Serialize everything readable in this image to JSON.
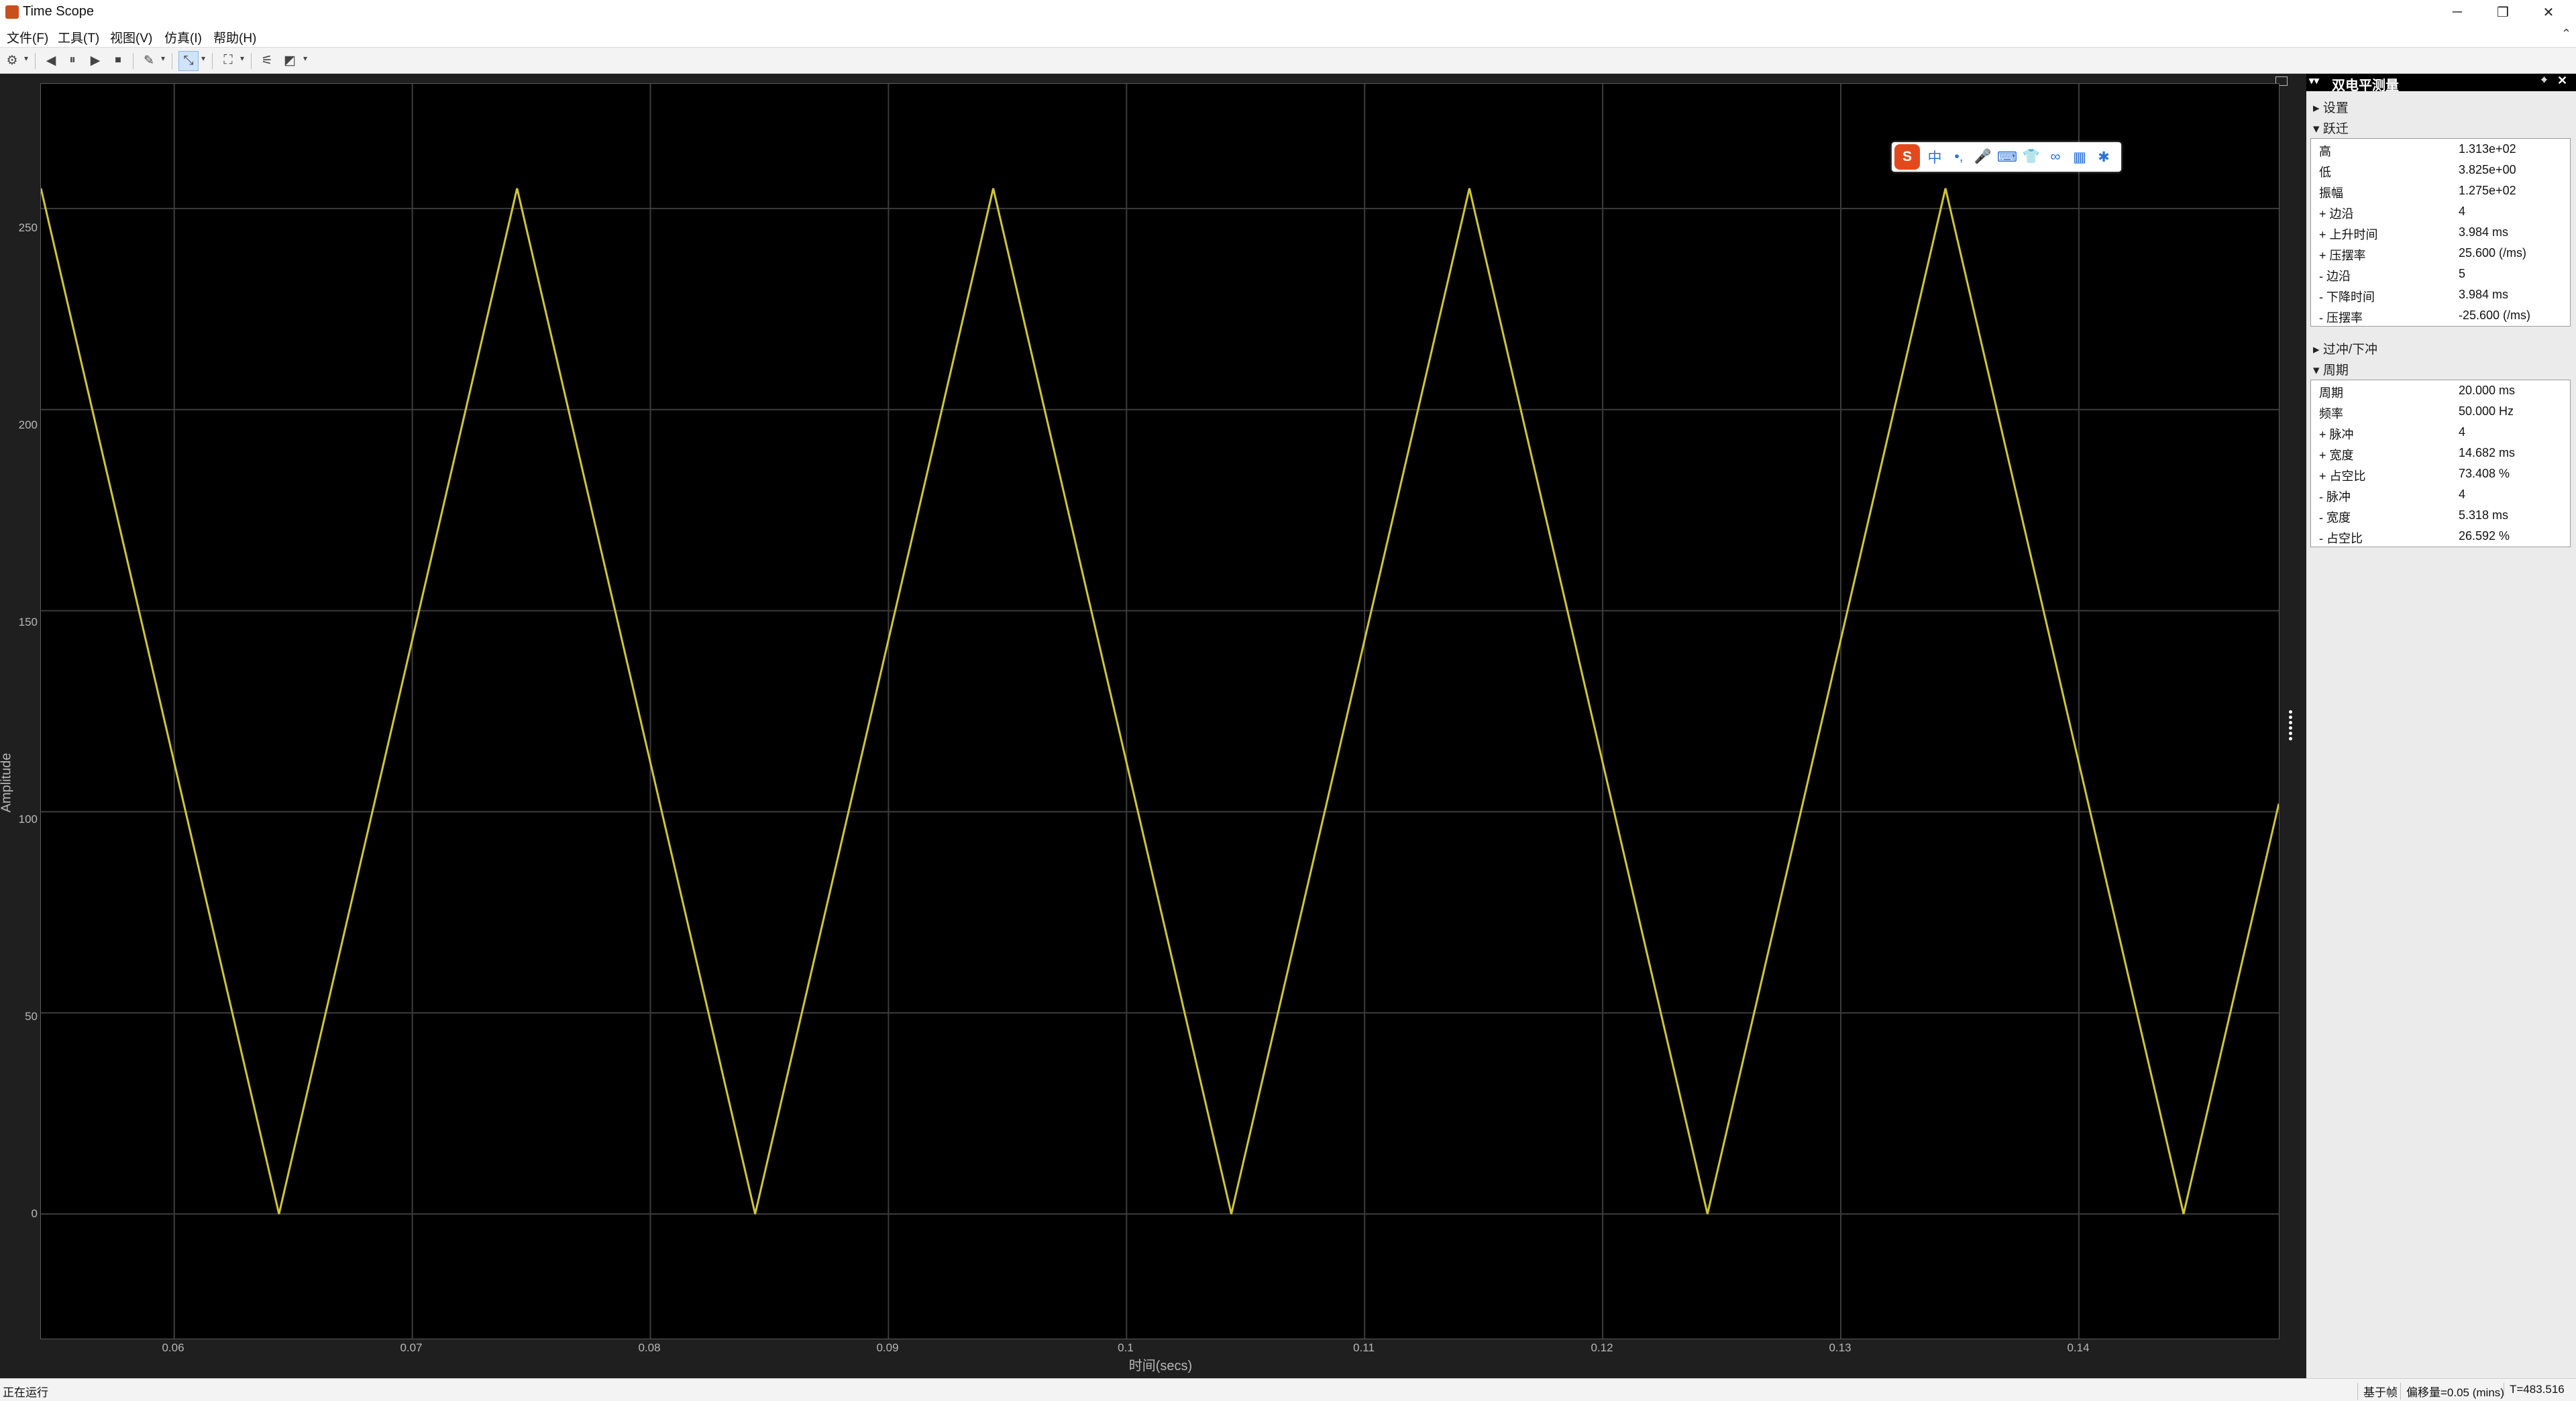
{
  "window": {
    "title": "Time Scope",
    "minimize": "─",
    "restore": "❐",
    "close": "✕"
  },
  "menu": [
    "文件(F)",
    "工具(T)",
    "视图(V)",
    "仿真(I)",
    "帮助(H)"
  ],
  "plot": {
    "y_label": "Amplitude",
    "x_label": "时间(secs)",
    "y_ticks": [
      "0",
      "50",
      "100",
      "150",
      "200",
      "250"
    ],
    "x_ticks": [
      "0.06",
      "0.07",
      "0.08",
      "0.09",
      "0.1",
      "0.11",
      "0.12",
      "0.13",
      "0.14"
    ],
    "trace_color": "#d2c635"
  },
  "chart_data": {
    "type": "line",
    "xlabel": "时间(secs)",
    "ylabel": "Amplitude",
    "xlim": [
      0.0544,
      0.1484
    ],
    "ylim": [
      -31,
      281
    ],
    "series": [
      {
        "x": [
          0.0544,
          0.0644,
          0.0744,
          0.0844,
          0.0944,
          0.1044,
          0.1144,
          0.1244,
          0.1344,
          0.1444,
          0.1484
        ],
        "values": [
          255,
          0,
          255,
          0,
          255,
          0,
          255,
          0,
          255,
          0,
          102
        ]
      }
    ]
  },
  "panel": {
    "title": "双电平测量",
    "settings": "设置",
    "transitions": "跃迁",
    "overshoot": "过冲/下冲",
    "cycles": "周期",
    "transitions_rows": [
      {
        "label": "高",
        "value": "1.313e+02"
      },
      {
        "label": "低",
        "value": "3.825e+00"
      },
      {
        "label": "振幅",
        "value": "1.275e+02"
      },
      {
        "label": "+ 边沿",
        "value": "4"
      },
      {
        "label": "+ 上升时间",
        "value": "3.984 ms"
      },
      {
        "label": "+ 压摆率",
        "value": "25.600 (/ms)"
      },
      {
        "label": "- 边沿",
        "value": "5"
      },
      {
        "label": "- 下降时间",
        "value": "3.984 ms"
      },
      {
        "label": "- 压摆率",
        "value": "-25.600 (/ms)"
      }
    ],
    "cycles_rows": [
      {
        "label": "周期",
        "value": "20.000 ms"
      },
      {
        "label": "频率",
        "value": "50.000 Hz"
      },
      {
        "label": "+ 脉冲",
        "value": "4"
      },
      {
        "label": "+ 宽度",
        "value": "14.682 ms"
      },
      {
        "label": "+ 占空比",
        "value": "73.408 %"
      },
      {
        "label": "- 脉冲",
        "value": "4"
      },
      {
        "label": "- 宽度",
        "value": "5.318 ms"
      },
      {
        "label": "- 占空比",
        "value": "26.592 %"
      }
    ]
  },
  "ime": {
    "logo": "S",
    "mode": "中"
  },
  "status": {
    "left": "正在运行",
    "mode": "基于帧",
    "offset": "偏移量=0.05 (mins)",
    "time": "T=483.516"
  }
}
